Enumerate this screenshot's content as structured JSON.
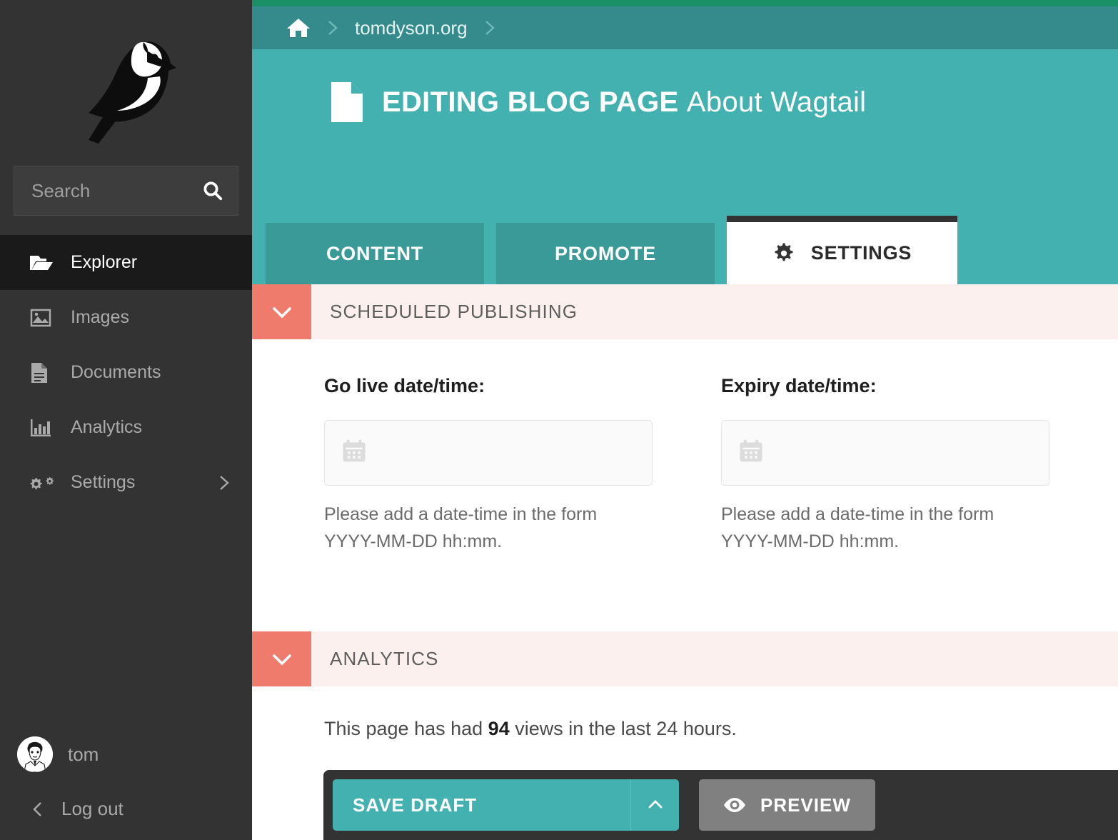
{
  "colors": {
    "top_strip_green": "#1a9067",
    "breadcrumb_teal": "#358b8b",
    "header_teal": "#43b1b0",
    "tab_inactive_teal": "#3a9a98",
    "sidebar_dark": "#333333",
    "sidebar_active": "#1a1a1a",
    "section_toggle_salmon": "#ef7b6d",
    "section_head_pink": "#fcf0ef",
    "preview_gray": "#808080"
  },
  "sidebar": {
    "logo_name": "wagtail-bird-logo",
    "search": {
      "placeholder": "Search",
      "value": "",
      "icon": "search-icon"
    },
    "items": [
      {
        "label": "Explorer",
        "icon": "folder-open-icon",
        "active": true,
        "has_chevron": false
      },
      {
        "label": "Images",
        "icon": "image-icon",
        "active": false,
        "has_chevron": false
      },
      {
        "label": "Documents",
        "icon": "document-icon",
        "active": false,
        "has_chevron": false
      },
      {
        "label": "Analytics",
        "icon": "bar-chart-icon",
        "active": false,
        "has_chevron": false
      },
      {
        "label": "Settings",
        "icon": "gears-icon",
        "active": false,
        "has_chevron": true
      }
    ],
    "user": {
      "name": "tom",
      "avatar_icon": "user-avatar"
    },
    "logout": {
      "label": "Log out",
      "icon": "chevron-left-icon"
    }
  },
  "breadcrumb": {
    "home_icon": "home-icon",
    "separator_icon": "chevron-right-icon",
    "site": "tomdyson.org"
  },
  "header": {
    "doc_icon": "page-document-icon",
    "title_prefix": "EDITING BLOG PAGE",
    "title_name": "About Wagtail"
  },
  "tabs": [
    {
      "label": "CONTENT",
      "active": false,
      "icon": null
    },
    {
      "label": "PROMOTE",
      "active": false,
      "icon": null
    },
    {
      "label": "SETTINGS",
      "active": true,
      "icon": "gear-icon"
    }
  ],
  "sections": {
    "scheduled_publishing": {
      "title": "SCHEDULED PUBLISHING",
      "toggle_icon": "chevron-down-icon",
      "fields": [
        {
          "label": "Go live date/time:",
          "value": "",
          "placeholder": "",
          "icon": "calendar-icon",
          "help": "Please add a date-time in the form YYYY-MM-DD hh:mm."
        },
        {
          "label": "Expiry date/time:",
          "value": "",
          "placeholder": "",
          "icon": "calendar-icon",
          "help": "Please add a date-time in the form YYYY-MM-DD hh:mm."
        }
      ]
    },
    "analytics": {
      "title": "ANALYTICS",
      "toggle_icon": "chevron-down-icon",
      "text_before": "This page has had ",
      "views_count": "94",
      "text_after": " views in the last 24 hours."
    }
  },
  "action_bar": {
    "save_label": "SAVE DRAFT",
    "save_dropdown_icon": "chevron-up-icon",
    "preview_label": "PREVIEW",
    "preview_icon": "eye-icon"
  }
}
